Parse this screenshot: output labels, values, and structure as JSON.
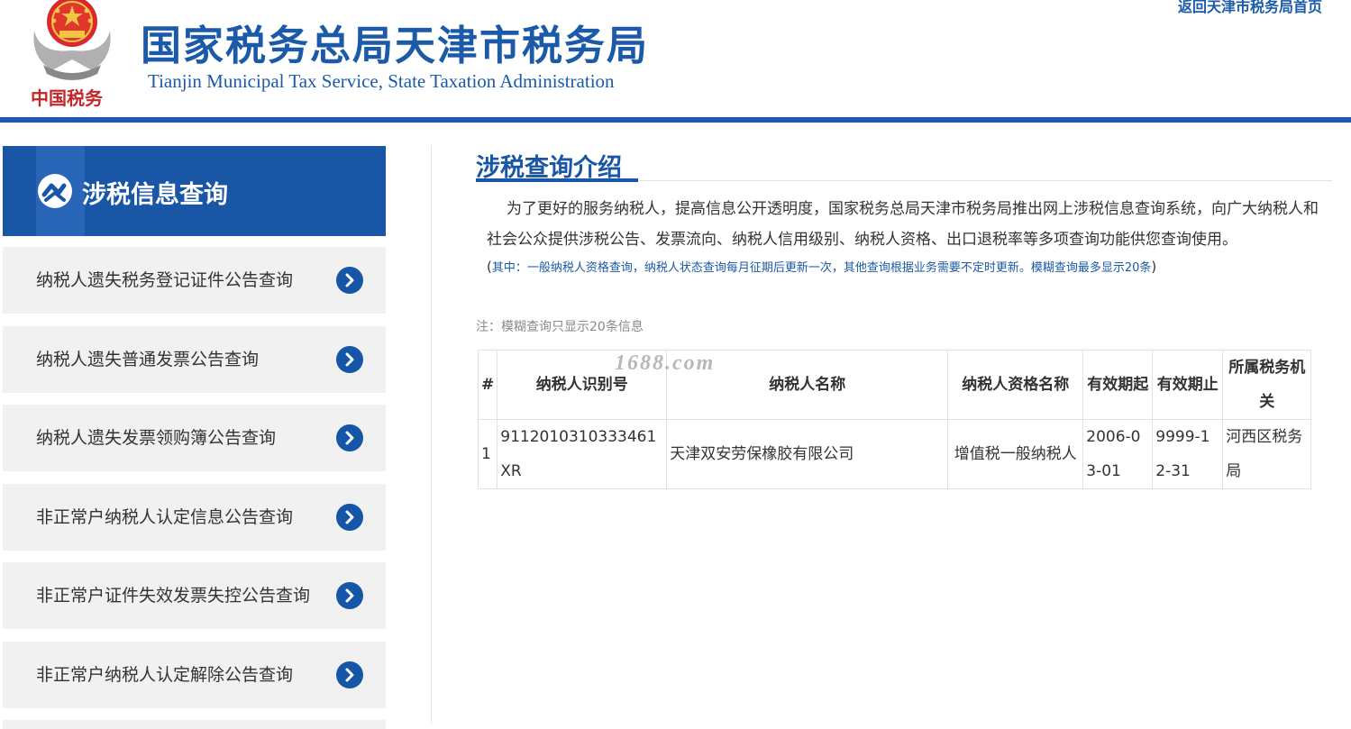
{
  "header": {
    "title": "国家税务总局天津市税务局",
    "subtitle": "Tianjin Municipal Tax Service, State Taxation Administration",
    "home_link": "返回天津市税务局首页",
    "emblem_caption": "中国税务"
  },
  "sidebar": {
    "title": "涉税信息查询",
    "items": [
      {
        "label": "纳税人遗失税务登记证件公告查询"
      },
      {
        "label": "纳税人遗失普通发票公告查询"
      },
      {
        "label": "纳税人遗失发票领购簿公告查询"
      },
      {
        "label": "非正常户纳税人认定信息公告查询"
      },
      {
        "label": "非正常户证件失效发票失控公告查询"
      },
      {
        "label": "非正常户纳税人认定解除公告查询"
      }
    ]
  },
  "main": {
    "section_title": "涉税查询介绍",
    "intro": "为了更好的服务纳税人，提高信息公开透明度，国家税务总局天津市税务局推出网上涉税信息查询系统，向广大纳税人和社会公众提供涉税公告、发票流向、纳税人信用级别、纳税人资格、出口退税率等多项查询功能供您查询使用。",
    "note_open": "(",
    "note": "其中：一般纳税人资格查询，纳税人状态查询每月征期后更新一次，其他查询根据业务需要不定时更新。模糊查询最多显示20条",
    "note_close": ")",
    "fuzzy_note": "注：模糊查询只显示20条信息",
    "watermark": "1688.com"
  },
  "table": {
    "headers": [
      "#",
      "纳税人识别号",
      "纳税人名称",
      "纳税人资格名称",
      "有效期起",
      "有效期止",
      "所属税务机关"
    ],
    "rows": [
      [
        "1",
        "9112010310333461XR",
        "天津双安劳保橡胶有限公司",
        "增值税一般纳税人",
        "2006-03-01",
        "9999-12-31",
        "河西区税务局"
      ]
    ]
  },
  "colors": {
    "brand_blue": "#1a56a6",
    "item_bg": "#f1f1f1"
  }
}
